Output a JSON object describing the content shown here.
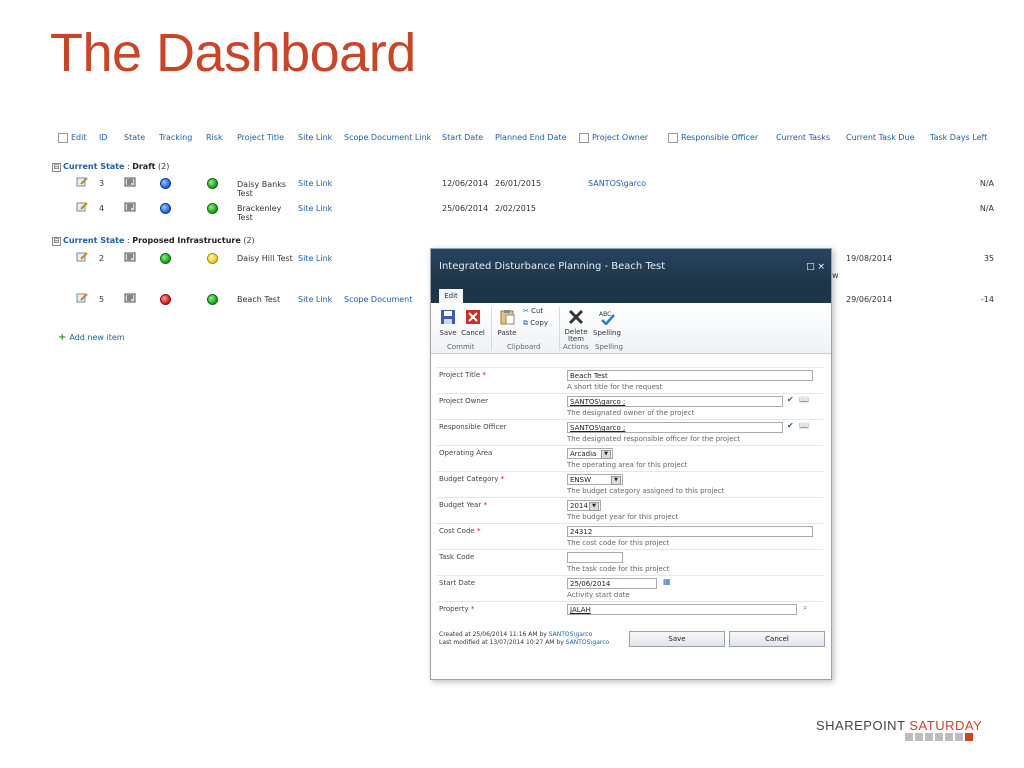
{
  "title": "The Dashboard",
  "list": {
    "headers": {
      "edit": "Edit",
      "id": "ID",
      "state": "State",
      "tracking": "Tracking",
      "risk": "Risk",
      "project_title": "Project Title",
      "site_link": "Site Link",
      "scope_link": "Scope Document Link",
      "start_date": "Start Date",
      "planned_end": "Planned End Date",
      "owner": "Project Owner",
      "officer": "Responsible Officer",
      "tasks": "Current Tasks",
      "task_due": "Current Task Due",
      "days_left": "Task Days Left"
    },
    "groups": [
      {
        "toggle": "⊟",
        "label": "Current State",
        "sep": " : ",
        "value": "Draft",
        "count": "(2)",
        "rows": [
          {
            "id": "3",
            "tracking": "blue",
            "risk": "green",
            "title": "Daisy Banks Test",
            "site": "Site Link",
            "scope": "",
            "start": "12/06/2014",
            "end": "26/01/2015",
            "owner": "SANTOS\\garco",
            "officer": "",
            "tasks": "",
            "due": "",
            "days": "N/A"
          },
          {
            "id": "4",
            "tracking": "blue",
            "risk": "green",
            "title": "Brackenley Test",
            "site": "Site Link",
            "scope": "",
            "start": "25/06/2014",
            "end": "2/02/2015",
            "owner": "",
            "officer": "",
            "tasks": "",
            "due": "",
            "days": "N/A"
          }
        ]
      },
      {
        "toggle": "⊟",
        "label": "Current State",
        "sep": " : ",
        "value": "Proposed Infrastructure",
        "count": "(2)",
        "rows": [
          {
            "id": "2",
            "tracking": "green",
            "risk": "yellow",
            "title": "Daisy Hill Test",
            "site": "Site Link",
            "scope": "",
            "start": "",
            "end": "",
            "owner": "",
            "officer": "",
            "tasks": "w",
            "due": "19/08/2014",
            "days": "35"
          },
          {
            "id": "5",
            "tracking": "red",
            "risk": "green",
            "title": "Beach Test",
            "site": "Site Link",
            "scope": "Scope Document",
            "start": "",
            "end": "",
            "owner": "",
            "officer": "",
            "tasks": "",
            "due": "29/06/2014",
            "days": "-14"
          }
        ]
      }
    ],
    "add_new": "Add new item"
  },
  "dialog": {
    "title": "Integrated Disturbance Planning - Beach Test",
    "controls": "□ ×",
    "tab": "Edit",
    "ribbon": {
      "save": "Save",
      "cancel": "Cancel",
      "paste": "Paste",
      "cut": "Cut",
      "copy": "Copy",
      "delete": "Delete Item",
      "spelling": "Spelling",
      "groups": {
        "commit": "Commit",
        "clipboard": "Clipboard",
        "actions": "Actions",
        "spelling": "Spelling"
      }
    },
    "fields": [
      {
        "label": "Project Title",
        "required": true,
        "value": "Beach Test",
        "desc": "A short title for the request",
        "kind": "text"
      },
      {
        "label": "Project Owner",
        "required": false,
        "value": "SANTOS\\garco ;",
        "desc": "The designated owner of the project",
        "kind": "people"
      },
      {
        "label": "Responsible Officer",
        "required": false,
        "value": "SANTOS\\garco ;",
        "desc": "The designated responsible officer for the project",
        "kind": "people"
      },
      {
        "label": "Operating Area",
        "required": false,
        "value": "Arcadia",
        "desc": "The operating area for this project",
        "kind": "select"
      },
      {
        "label": "Budget Category",
        "required": true,
        "value": "ENSW",
        "desc": "The budget category assigned to this project",
        "kind": "select"
      },
      {
        "label": "Budget Year",
        "required": true,
        "value": "2014",
        "desc": "The budget year for this project",
        "kind": "select"
      },
      {
        "label": "Cost Code",
        "required": true,
        "value": "24312",
        "desc": "The cost code for this project",
        "kind": "text"
      },
      {
        "label": "Task Code",
        "required": false,
        "value": "",
        "desc": "The task code for this project",
        "kind": "short"
      },
      {
        "label": "Start Date",
        "required": false,
        "value": "25/06/2014",
        "desc": "Activity start date",
        "kind": "date"
      },
      {
        "label": "Property",
        "required": true,
        "value": "JALAH",
        "desc": "",
        "kind": "lookup"
      }
    ],
    "created": {
      "prefix": "Created at 25/06/2014 11:16 AM by ",
      "user": "SANTOS\\garco"
    },
    "modified": {
      "prefix": "Last modified at 13/07/2014 10:27 AM by ",
      "user": "SANTOS\\garco"
    },
    "save_btn": "Save",
    "cancel_btn": "Cancel"
  },
  "logo": {
    "part1": "SHAREPOINT ",
    "part2": "SATURDAY"
  }
}
